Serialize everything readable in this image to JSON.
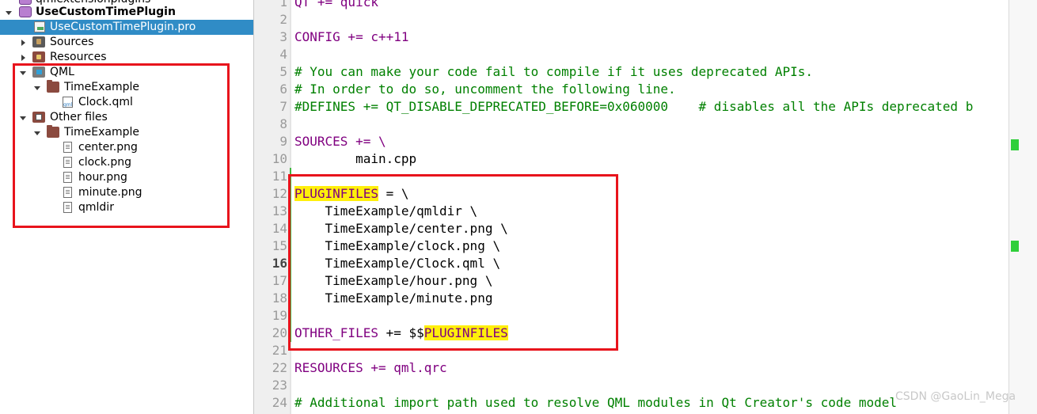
{
  "project_tree": {
    "items": [
      {
        "label": "qmlextensionplugins",
        "bold": false,
        "expanded": null,
        "icon": "project-icon"
      },
      {
        "label": "UseCustomTimePlugin",
        "bold": true,
        "expanded": true,
        "icon": "project-icon"
      },
      {
        "label": "UseCustomTimePlugin.pro",
        "bold": false,
        "selected": true,
        "icon": "pro-file-icon"
      },
      {
        "label": "Sources",
        "bold": false,
        "expanded": false,
        "icon": "sources-folder-icon"
      },
      {
        "label": "Resources",
        "bold": false,
        "expanded": false,
        "icon": "resources-folder-icon"
      },
      {
        "label": "QML",
        "bold": false,
        "expanded": true,
        "icon": "qml-folder-icon"
      },
      {
        "label": "TimeExample",
        "bold": false,
        "expanded": true,
        "icon": "folder-icon"
      },
      {
        "label": "Clock.qml",
        "bold": false,
        "icon": "qml-file-icon"
      },
      {
        "label": "Other files",
        "bold": false,
        "expanded": true,
        "icon": "other-files-folder-icon"
      },
      {
        "label": "TimeExample",
        "bold": false,
        "expanded": true,
        "icon": "folder-icon"
      },
      {
        "label": "center.png",
        "bold": false,
        "icon": "file-icon"
      },
      {
        "label": "clock.png",
        "bold": false,
        "icon": "file-icon"
      },
      {
        "label": "hour.png",
        "bold": false,
        "icon": "file-icon"
      },
      {
        "label": "minute.png",
        "bold": false,
        "icon": "file-icon"
      },
      {
        "label": "qmldir",
        "bold": false,
        "icon": "file-icon"
      }
    ]
  },
  "editor": {
    "current_line": "16",
    "lines": [
      {
        "num": "1",
        "text": "QT += quick"
      },
      {
        "num": "2",
        "text": ""
      },
      {
        "num": "3",
        "text": "CONFIG += c++11"
      },
      {
        "num": "4",
        "text": ""
      },
      {
        "num": "5",
        "text": "# You can make your code fail to compile if it uses deprecated APIs."
      },
      {
        "num": "6",
        "text": "# In order to do so, uncomment the following line."
      },
      {
        "num": "7",
        "text": "#DEFINES += QT_DISABLE_DEPRECATED_BEFORE=0x060000    # disables all the APIs deprecated b"
      },
      {
        "num": "8",
        "text": ""
      },
      {
        "num": "9",
        "text": "SOURCES += \\"
      },
      {
        "num": "10",
        "text": "        main.cpp"
      },
      {
        "num": "11",
        "text": ""
      },
      {
        "num": "12",
        "text": "PLUGINFILES = \\"
      },
      {
        "num": "13",
        "text": "    TimeExample/qmldir \\"
      },
      {
        "num": "14",
        "text": "    TimeExample/center.png \\"
      },
      {
        "num": "15",
        "text": "    TimeExample/clock.png \\"
      },
      {
        "num": "16",
        "text": "    TimeExample/Clock.qml \\"
      },
      {
        "num": "17",
        "text": "    TimeExample/hour.png \\"
      },
      {
        "num": "18",
        "text": "    TimeExample/minute.png"
      },
      {
        "num": "19",
        "text": ""
      },
      {
        "num": "20",
        "text": "OTHER_FILES += $$PLUGINFILES"
      },
      {
        "num": "21",
        "text": ""
      },
      {
        "num": "22",
        "text": "RESOURCES += qml.qrc"
      },
      {
        "num": "23",
        "text": ""
      },
      {
        "num": "24",
        "text": "# Additional import path used to resolve QML modules in Qt Creator's code model"
      }
    ],
    "highlight_word": "PLUGINFILES"
  },
  "watermark": "CSDN @GaoLin_Mega",
  "colors": {
    "selection": "#308cc6",
    "annotation_box": "#e8141c",
    "keyword": "#800080",
    "comment": "#008000",
    "search_highlight": "#ffef0b",
    "change_marker": "#41b641"
  }
}
